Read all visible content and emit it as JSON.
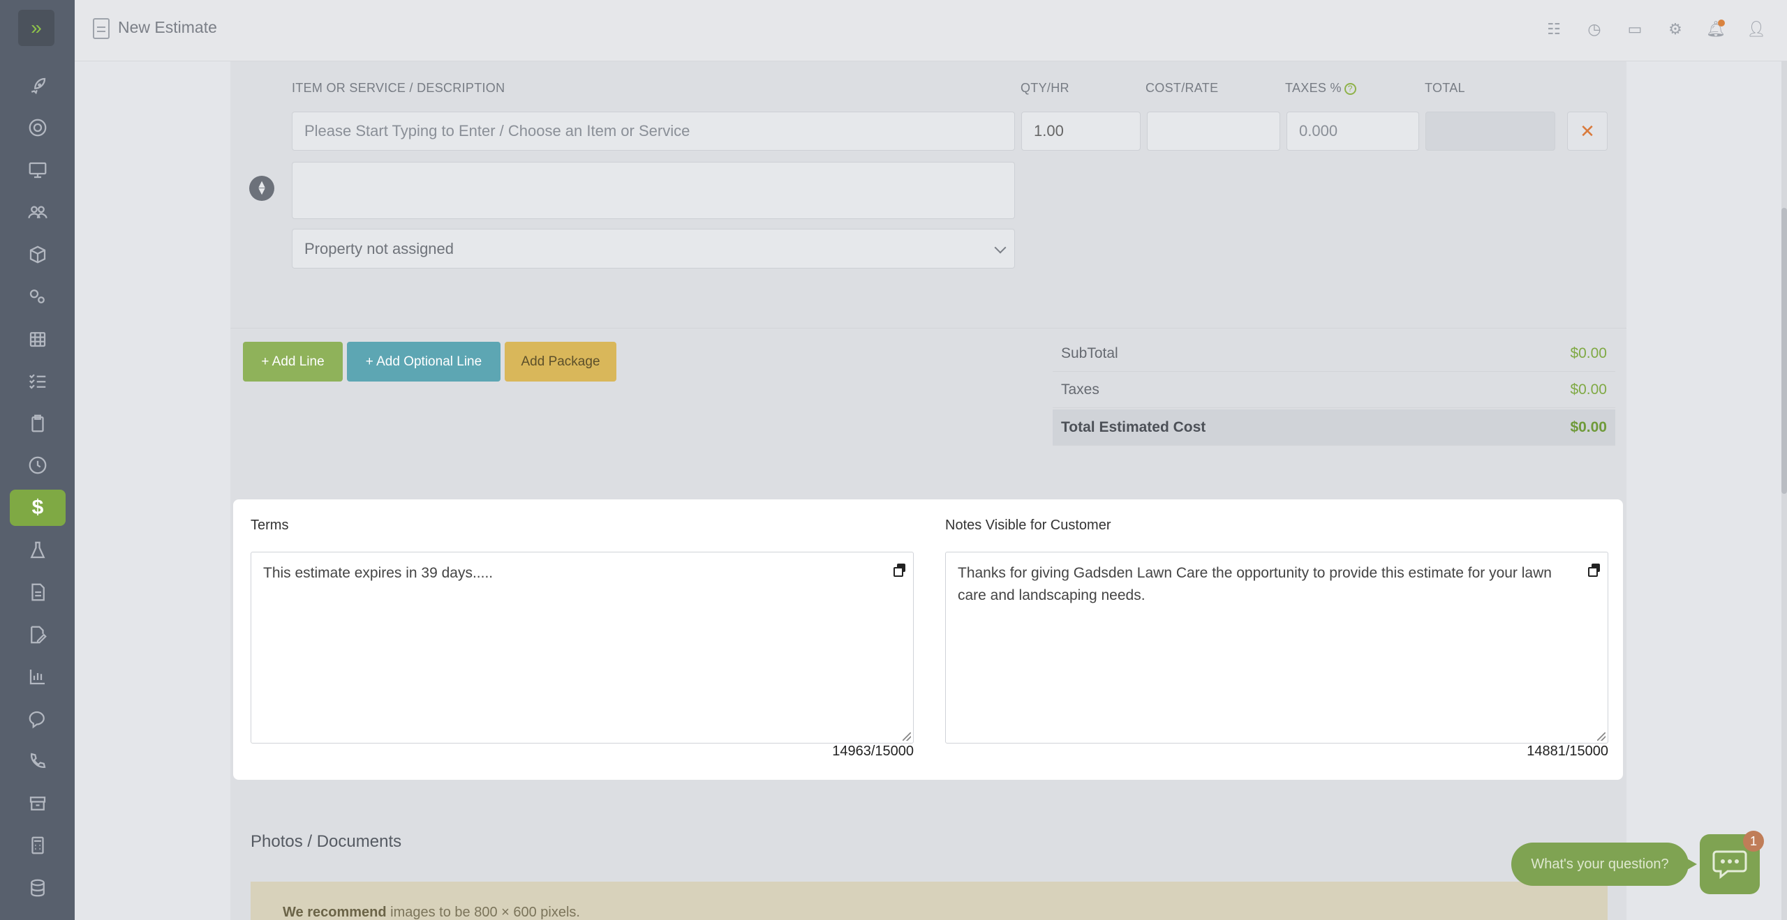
{
  "header": {
    "title": "New Estimate"
  },
  "sidebar": {
    "icons": [
      "rocket-icon",
      "support-icon",
      "desktop-icon",
      "users-icon",
      "box-icon",
      "gears-icon",
      "calendar-icon",
      "checklist-icon",
      "clipboard-icon",
      "clock-icon",
      "dollar-icon",
      "flask-icon",
      "file-icon",
      "signature-icon",
      "chart-icon",
      "chat-icon",
      "phone-icon",
      "archive-icon",
      "calculator-icon",
      "database-icon"
    ],
    "active_label": "$"
  },
  "line_items": {
    "columns": {
      "item": "ITEM OR SERVICE / DESCRIPTION",
      "qty": "QTY/HR",
      "cost": "COST/RATE",
      "taxes": "TAXES %",
      "total": "TOTAL"
    },
    "help_glyph": "?",
    "item_placeholder": "Please Start Typing to Enter / Choose an Item or Service",
    "qty_value": "1.00",
    "tax_placeholder": "0.000",
    "delete_glyph": "✕",
    "property_select": "Property not assigned"
  },
  "actions": {
    "add_line": "+ Add Line",
    "add_optional_line": "+ Add Optional Line",
    "add_package": "Add Package"
  },
  "totals": {
    "subtotal_label": "SubTotal",
    "subtotal_value": "$0.00",
    "taxes_label": "Taxes",
    "taxes_value": "$0.00",
    "total_label": "Total Estimated Cost",
    "total_value": "$0.00"
  },
  "terms": {
    "label": "Terms",
    "value": "This estimate expires in 39 days.....",
    "counter": "14963/15000"
  },
  "notes": {
    "label": "Notes Visible for Customer",
    "value": "Thanks for giving Gadsden Lawn Care the opportunity to provide this estimate for your lawn care and landscaping needs.",
    "counter": "14881/15000"
  },
  "photos": {
    "title": "Photos / Documents",
    "recommend_bold": "We recommend",
    "recommend_rest": " images to be 800 × 600 pixels."
  },
  "chat": {
    "prompt": "What's your question?",
    "badge": "1"
  },
  "colors": {
    "accent_green": "#7fa944",
    "teal": "#5da6b3",
    "yellow": "#d9b75a",
    "danger": "#d97a3c"
  }
}
